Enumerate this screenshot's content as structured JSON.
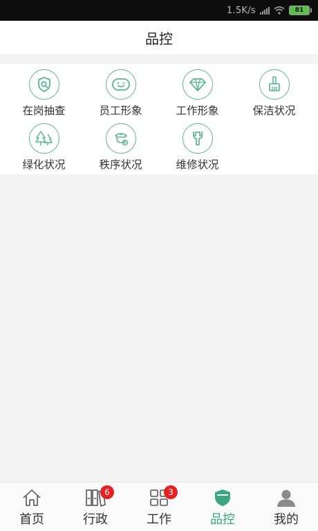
{
  "status_bar": {
    "net_speed": "1.5K/s",
    "battery": "81"
  },
  "header": {
    "title": "品控"
  },
  "grid": {
    "items": [
      {
        "label": "在岗抽查",
        "icon": "shield-search-icon"
      },
      {
        "label": "员工形象",
        "icon": "smile-face-icon"
      },
      {
        "label": "工作形象",
        "icon": "diamond-icon"
      },
      {
        "label": "保洁状况",
        "icon": "broom-icon"
      },
      {
        "label": "绿化状况",
        "icon": "trees-icon"
      },
      {
        "label": "秩序状况",
        "icon": "guard-icon"
      },
      {
        "label": "维修状况",
        "icon": "wrench-icon"
      }
    ]
  },
  "tab_bar": {
    "tabs": [
      {
        "label": "首页",
        "icon": "home-icon"
      },
      {
        "label": "行政",
        "icon": "binders-icon",
        "badge": "6"
      },
      {
        "label": "工作",
        "icon": "grid-icon",
        "badge": "3"
      },
      {
        "label": "品控",
        "icon": "shield-icon",
        "active": true
      },
      {
        "label": "我的",
        "icon": "user-icon"
      }
    ]
  },
  "colors": {
    "accent": "#3aa57f",
    "icon_stroke": "#59b590",
    "badge": "#e52121"
  }
}
